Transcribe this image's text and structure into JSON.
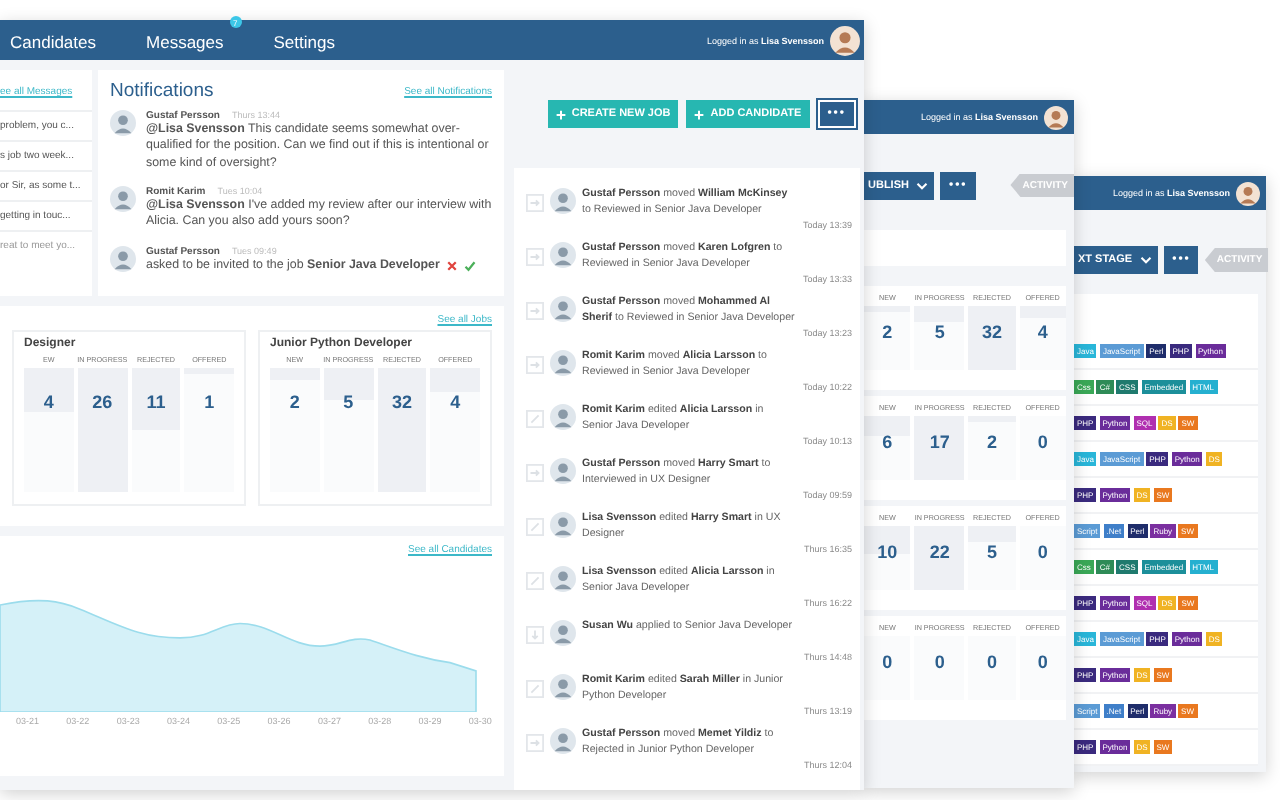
{
  "main_window": {
    "nav": [
      {
        "label": "Candidates"
      },
      {
        "label": "Messages",
        "badge": "7"
      },
      {
        "label": "Settings"
      }
    ],
    "user": {
      "prefix": "Logged in as",
      "name": "Lisa Svensson"
    },
    "messages": {
      "link": "ee all Messages",
      "snippets": [
        {
          "text": "problem, you c...",
          "faded": false
        },
        {
          "text": "s job two week...",
          "faded": false
        },
        {
          "text": "or Sir, as some t...",
          "faded": false
        },
        {
          "text": "getting in touc...",
          "faded": false
        },
        {
          "text": "reat to meet yo...",
          "faded": true
        }
      ]
    },
    "notifications": {
      "title": "Notifications",
      "link": "See all Notifications",
      "items": [
        {
          "kind": "comment",
          "author": "Gustaf Persson",
          "time": "Thurs 13:44",
          "text": "**@Lisa Svensson** This candidate seems somewhat over-qualified for the position. Can we find out if this is intentional or some kind of oversight?"
        },
        {
          "kind": "comment",
          "author": "Romit Karim",
          "time": "Tues 10:04",
          "text": "**@Lisa Svensson** I've added my review after our interview with Alicia. Can you also add yours soon?"
        },
        {
          "kind": "request",
          "author": "Gustaf Persson",
          "time": "Tues 09:49",
          "text": "asked to be invited to the job **Senior Java Developer**"
        }
      ]
    },
    "actions": [
      {
        "label": "CREATE NEW JOB",
        "kind": "add"
      },
      {
        "label": "ADD CANDIDATE",
        "kind": "add"
      },
      {
        "label": "•••",
        "kind": "more"
      }
    ],
    "jobs": {
      "link": "See all Jobs",
      "cards": [
        {
          "title": "Designer",
          "columns": [
            {
              "label": "EW",
              "count": "4",
              "level": 0.35
            },
            {
              "label": "IN PROGRESS",
              "count": "26",
              "level": 1
            },
            {
              "label": "REJECTED",
              "count": "11",
              "level": 0.5
            },
            {
              "label": "OFFERED",
              "count": "1",
              "level": 0.05
            }
          ]
        },
        {
          "title": "Junior Python Developer",
          "columns": [
            {
              "label": "NEW",
              "count": "2",
              "level": 0.1
            },
            {
              "label": "IN PROGRESS",
              "count": "5",
              "level": 0.25
            },
            {
              "label": "REJECTED",
              "count": "32",
              "level": 1
            },
            {
              "label": "OFFERED",
              "count": "4",
              "level": 0.2
            }
          ]
        }
      ]
    },
    "candidates_chart": {
      "link": "See all Candidates",
      "x_labels": [
        "03-21",
        "03-22",
        "03-23",
        "03-24",
        "03-25",
        "03-26",
        "03-27",
        "03-28",
        "03-29",
        "03-30"
      ]
    },
    "activity": [
      {
        "kind": "move",
        "text": "**Gustaf Persson** moved **William McKinsey** to Reviewed in Senior Java Developer",
        "time": "Today 13:39"
      },
      {
        "kind": "move",
        "text": "**Gustaf Persson** moved **Karen Lofgren** to Reviewed in Senior Java Developer",
        "time": "Today 13:33"
      },
      {
        "kind": "move",
        "text": "**Gustaf Persson** moved **Mohammed Al Sherif** to Reviewed in Senior Java Developer",
        "time": "Today 13:23"
      },
      {
        "kind": "move",
        "text": "**Romit Karim** moved **Alicia Larsson** to Reviewed in Senior Java Developer",
        "time": "Today 10:22"
      },
      {
        "kind": "edit",
        "text": "**Romit Karim** edited **Alicia Larsson** in Senior Java Developer",
        "time": "Today 10:13"
      },
      {
        "kind": "move",
        "text": "**Gustaf Persson** moved **Harry Smart** to Interviewed in UX Designer",
        "time": "Today 09:59"
      },
      {
        "kind": "edit",
        "text": "**Lisa Svensson** edited **Harry Smart** in UX Designer",
        "time": "Thurs 16:35"
      },
      {
        "kind": "edit",
        "text": "**Lisa Svensson** edited **Alicia Larsson** in Senior Java Developer",
        "time": "Thurs 16:22"
      },
      {
        "kind": "apply",
        "text": "**Susan Wu** applied to Senior Java Developer",
        "time": "Thurs 14:48"
      },
      {
        "kind": "edit",
        "text": "**Romit Karim** edited **Sarah Miller** in Junior Python Developer",
        "time": "Thurs 13:19"
      },
      {
        "kind": "move",
        "text": "**Gustaf Persson** moved **Memet Yildiz** to Rejected in Junior Python Developer",
        "time": "Thurs 12:04"
      }
    ]
  },
  "job_window": {
    "user": {
      "prefix": "Logged in as",
      "name": "Lisa Svensson"
    },
    "actions": [
      {
        "label": "UBLISH",
        "kind": "dropdown"
      },
      {
        "label": "•••",
        "kind": "more"
      },
      {
        "label": "ACTIVITY",
        "kind": "tab"
      }
    ],
    "stats": [
      {
        "columns": [
          {
            "label": "NEW",
            "count": "2",
            "level": 0.1
          },
          {
            "label": "IN PROGRESS",
            "count": "5",
            "level": 0.25
          },
          {
            "label": "REJECTED",
            "count": "32",
            "level": 1
          },
          {
            "label": "OFFERED",
            "count": "4",
            "level": 0.2
          }
        ]
      },
      {
        "columns": [
          {
            "label": "NEW",
            "count": "6",
            "level": 0.3
          },
          {
            "label": "IN PROGRESS",
            "count": "17",
            "level": 1
          },
          {
            "label": "REJECTED",
            "count": "2",
            "level": 0.1
          },
          {
            "label": "OFFERED",
            "count": "0"
          }
        ]
      },
      {
        "columns": [
          {
            "label": "NEW",
            "count": "10",
            "level": 0.45
          },
          {
            "label": "IN PROGRESS",
            "count": "22",
            "level": 1
          },
          {
            "label": "REJECTED",
            "count": "5",
            "level": 0.25
          },
          {
            "label": "OFFERED",
            "count": "0"
          }
        ]
      },
      {
        "columns": [
          {
            "label": "NEW",
            "count": "0"
          },
          {
            "label": "IN PROGRESS",
            "count": "0"
          },
          {
            "label": "REJECTED",
            "count": "0"
          },
          {
            "label": "OFFERED",
            "count": "0"
          }
        ]
      }
    ]
  },
  "stage_window": {
    "user": {
      "prefix": "Logged in as",
      "name": "Lisa Svensson"
    },
    "actions": [
      {
        "label": "XT STAGE",
        "kind": "dropdown"
      },
      {
        "label": "•••",
        "kind": "more"
      },
      {
        "label": "ACTIVITY",
        "kind": "tab"
      }
    ],
    "skill_rows": [
      {
        "tags": [
          {
            "label": "Java",
            "color": "#29b6d9"
          },
          {
            "label": "JavaScript",
            "color": "#5b9bd5"
          },
          {
            "label": "Perl",
            "color": "#1f2d6b"
          },
          {
            "label": "PHP",
            "color": "#3a2a7e"
          },
          {
            "label": "Python",
            "color": "#6a2c9a"
          }
        ]
      },
      {
        "tags": [
          {
            "label": "Css",
            "color": "#3aa857"
          },
          {
            "label": "C#",
            "color": "#2e8b57"
          },
          {
            "label": "CSS",
            "color": "#1f7a6e"
          },
          {
            "label": "Embedded",
            "color": "#1c8f9a"
          },
          {
            "label": "HTML",
            "color": "#25b0d0"
          }
        ]
      },
      {
        "tags": [
          {
            "label": "PHP",
            "color": "#3a2a7e"
          },
          {
            "label": "Python",
            "color": "#6a2c9a"
          },
          {
            "label": "SQL",
            "color": "#b02fb0"
          },
          {
            "label": "DS",
            "color": "#f0b323"
          },
          {
            "label": "SW",
            "color": "#e9781f"
          }
        ]
      },
      {
        "tags": [
          {
            "label": "Java",
            "color": "#29b6d9"
          },
          {
            "label": "JavaScript",
            "color": "#5b9bd5"
          },
          {
            "label": "PHP",
            "color": "#3a2a7e"
          },
          {
            "label": "Python",
            "color": "#6a2c9a"
          },
          {
            "label": "DS",
            "color": "#f0b323"
          }
        ]
      },
      {
        "tags": [
          {
            "label": "PHP",
            "color": "#3a2a7e"
          },
          {
            "label": "Python",
            "color": "#6a2c9a"
          },
          {
            "label": "DS",
            "color": "#f0b323"
          },
          {
            "label": "SW",
            "color": "#e9781f"
          }
        ]
      },
      {
        "tags": [
          {
            "label": "Script",
            "color": "#5b9bd5"
          },
          {
            "label": ".Net",
            "color": "#3f7fc9"
          },
          {
            "label": "Perl",
            "color": "#1f2d6b"
          },
          {
            "label": "Ruby",
            "color": "#7b2fa0"
          },
          {
            "label": "SW",
            "color": "#e9781f"
          }
        ]
      },
      {
        "tags": [
          {
            "label": "Css",
            "color": "#3aa857"
          },
          {
            "label": "C#",
            "color": "#2e8b57"
          },
          {
            "label": "CSS",
            "color": "#1f7a6e"
          },
          {
            "label": "Embedded",
            "color": "#1c8f9a"
          },
          {
            "label": "HTML",
            "color": "#25b0d0"
          }
        ]
      },
      {
        "tags": [
          {
            "label": "PHP",
            "color": "#3a2a7e"
          },
          {
            "label": "Python",
            "color": "#6a2c9a"
          },
          {
            "label": "SQL",
            "color": "#b02fb0"
          },
          {
            "label": "DS",
            "color": "#f0b323"
          },
          {
            "label": "SW",
            "color": "#e9781f"
          }
        ]
      },
      {
        "tags": [
          {
            "label": "Java",
            "color": "#29b6d9"
          },
          {
            "label": "JavaScript",
            "color": "#5b9bd5"
          },
          {
            "label": "PHP",
            "color": "#3a2a7e"
          },
          {
            "label": "Python",
            "color": "#6a2c9a"
          },
          {
            "label": "DS",
            "color": "#f0b323"
          }
        ]
      },
      {
        "tags": [
          {
            "label": "PHP",
            "color": "#3a2a7e"
          },
          {
            "label": "Python",
            "color": "#6a2c9a"
          },
          {
            "label": "DS",
            "color": "#f0b323"
          },
          {
            "label": "SW",
            "color": "#e9781f"
          }
        ]
      },
      {
        "tags": [
          {
            "label": "Script",
            "color": "#5b9bd5"
          },
          {
            "label": ".Net",
            "color": "#3f7fc9"
          },
          {
            "label": "Perl",
            "color": "#1f2d6b"
          },
          {
            "label": "Ruby",
            "color": "#7b2fa0"
          },
          {
            "label": "SW",
            "color": "#e9781f"
          }
        ]
      },
      {
        "tags": [
          {
            "label": "PHP",
            "color": "#3a2a7e"
          },
          {
            "label": "Python",
            "color": "#6a2c9a"
          },
          {
            "label": "DS",
            "color": "#f0b323"
          },
          {
            "label": "SW",
            "color": "#e9781f"
          }
        ]
      }
    ]
  }
}
